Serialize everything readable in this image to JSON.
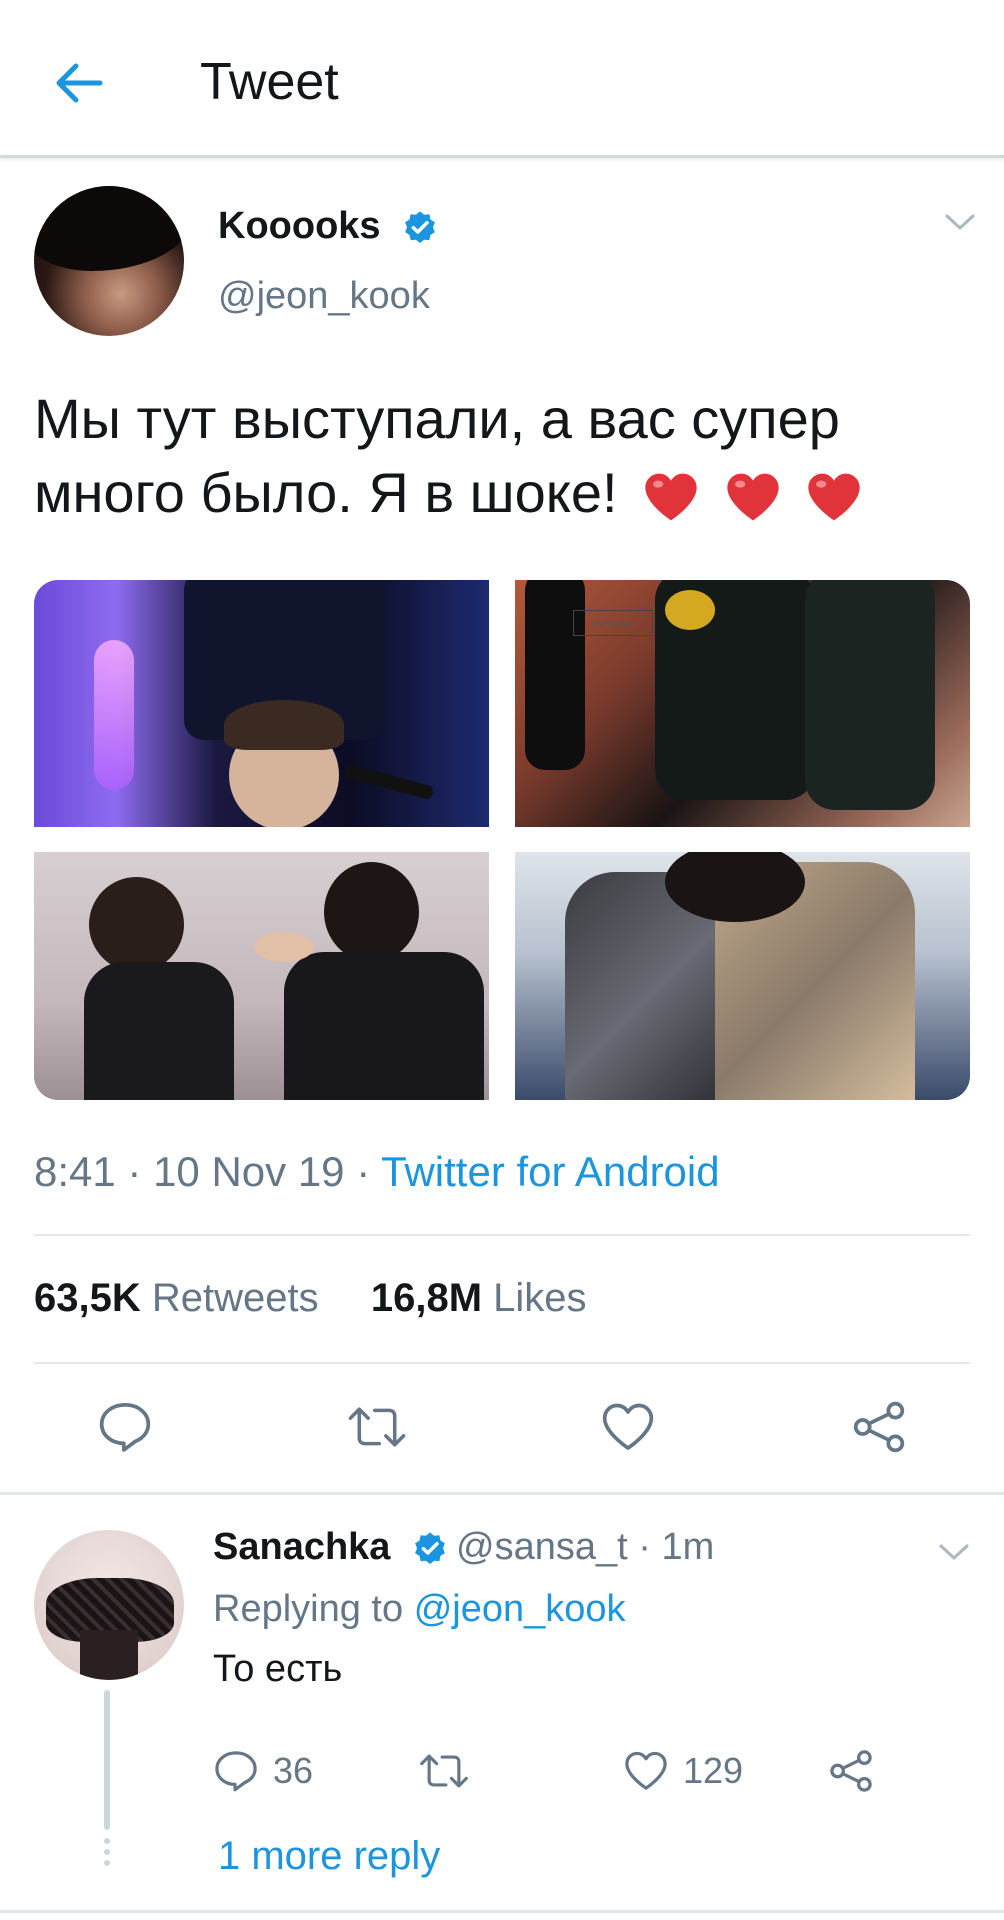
{
  "header": {
    "title": "Tweet",
    "back_icon": "arrow-left-icon",
    "accent_color": "#1b95e0"
  },
  "tweet": {
    "author_name": "Kooooks",
    "author_handle": "@jeon_kook",
    "verified": true,
    "text": "Мы тут выступали, а вас супер много было. Я в шоке!",
    "emoji": [
      "heart",
      "heart",
      "heart"
    ],
    "photos": [
      {
        "watermark": ""
      },
      {
        "watermark": "SMYfallen"
      },
      {
        "watermark": ""
      },
      {
        "watermark": ""
      }
    ],
    "time": "8:41",
    "date": "10 Nov 19",
    "separator": " · ",
    "source": "Twitter for Android",
    "retweets_count": "63,5K",
    "retweets_label": "Retweets",
    "likes_count": "16,8M",
    "likes_label": "Likes",
    "actions": [
      "reply-icon",
      "retweet-icon",
      "like-icon",
      "share-icon"
    ]
  },
  "reply": {
    "author_name": "Sanachka",
    "author_handle": "@sansa_t",
    "time": "1m",
    "verified": true,
    "replying_prefix": "Replying to",
    "replying_to": "@jeon_kook",
    "text": "То есть",
    "reply_count": "36",
    "retweet_count": "",
    "like_count": "129",
    "more_replies": "1 more reply"
  }
}
